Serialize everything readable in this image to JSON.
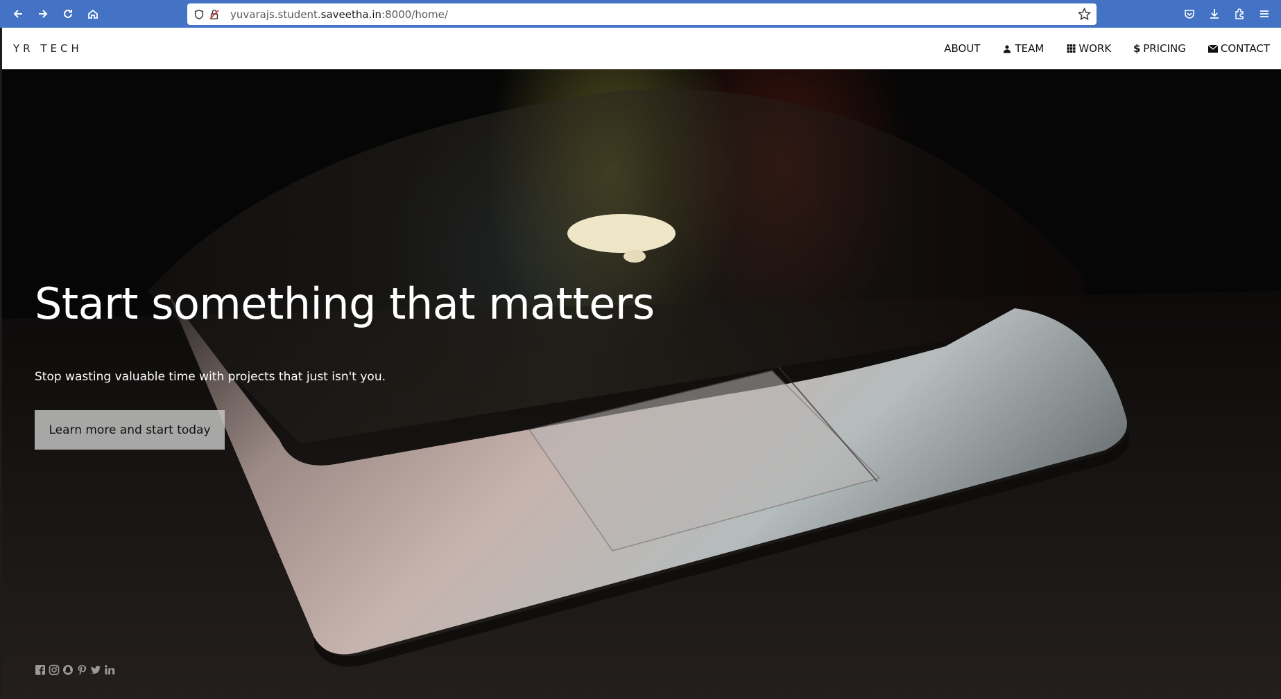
{
  "browser": {
    "url_prefix": "yuvarajs.student.",
    "url_domain": "saveetha.in",
    "url_suffix": ":8000/home/",
    "icons": [
      "back-icon",
      "forward-icon",
      "reload-icon",
      "home-icon",
      "shield-icon",
      "lock-icon",
      "star-icon",
      "pocket-icon",
      "download-icon",
      "extensions-icon",
      "menu-icon"
    ]
  },
  "site": {
    "logo": "YR TECH",
    "menu": [
      {
        "label": "ABOUT",
        "icon": ""
      },
      {
        "label": "TEAM",
        "icon": "user-icon"
      },
      {
        "label": "WORK",
        "icon": "grid-icon"
      },
      {
        "label": "PRICING",
        "icon": "dollar-icon"
      },
      {
        "label": "CONTACT",
        "icon": "envelope-icon"
      }
    ],
    "hero": {
      "title": "Start something that matters",
      "subtitle": "Stop wasting valuable time with projects that just isn't you.",
      "cta": "Learn more and start today"
    },
    "socials": [
      "facebook-icon",
      "instagram-icon",
      "snapchat-icon",
      "pinterest-icon",
      "twitter-icon",
      "linkedin-icon"
    ]
  },
  "colors": {
    "browser_bar": "#4472c4",
    "header_bg": "#ffffff",
    "hero_bg": "#060606",
    "cta_bg": "#c8c8c8"
  }
}
